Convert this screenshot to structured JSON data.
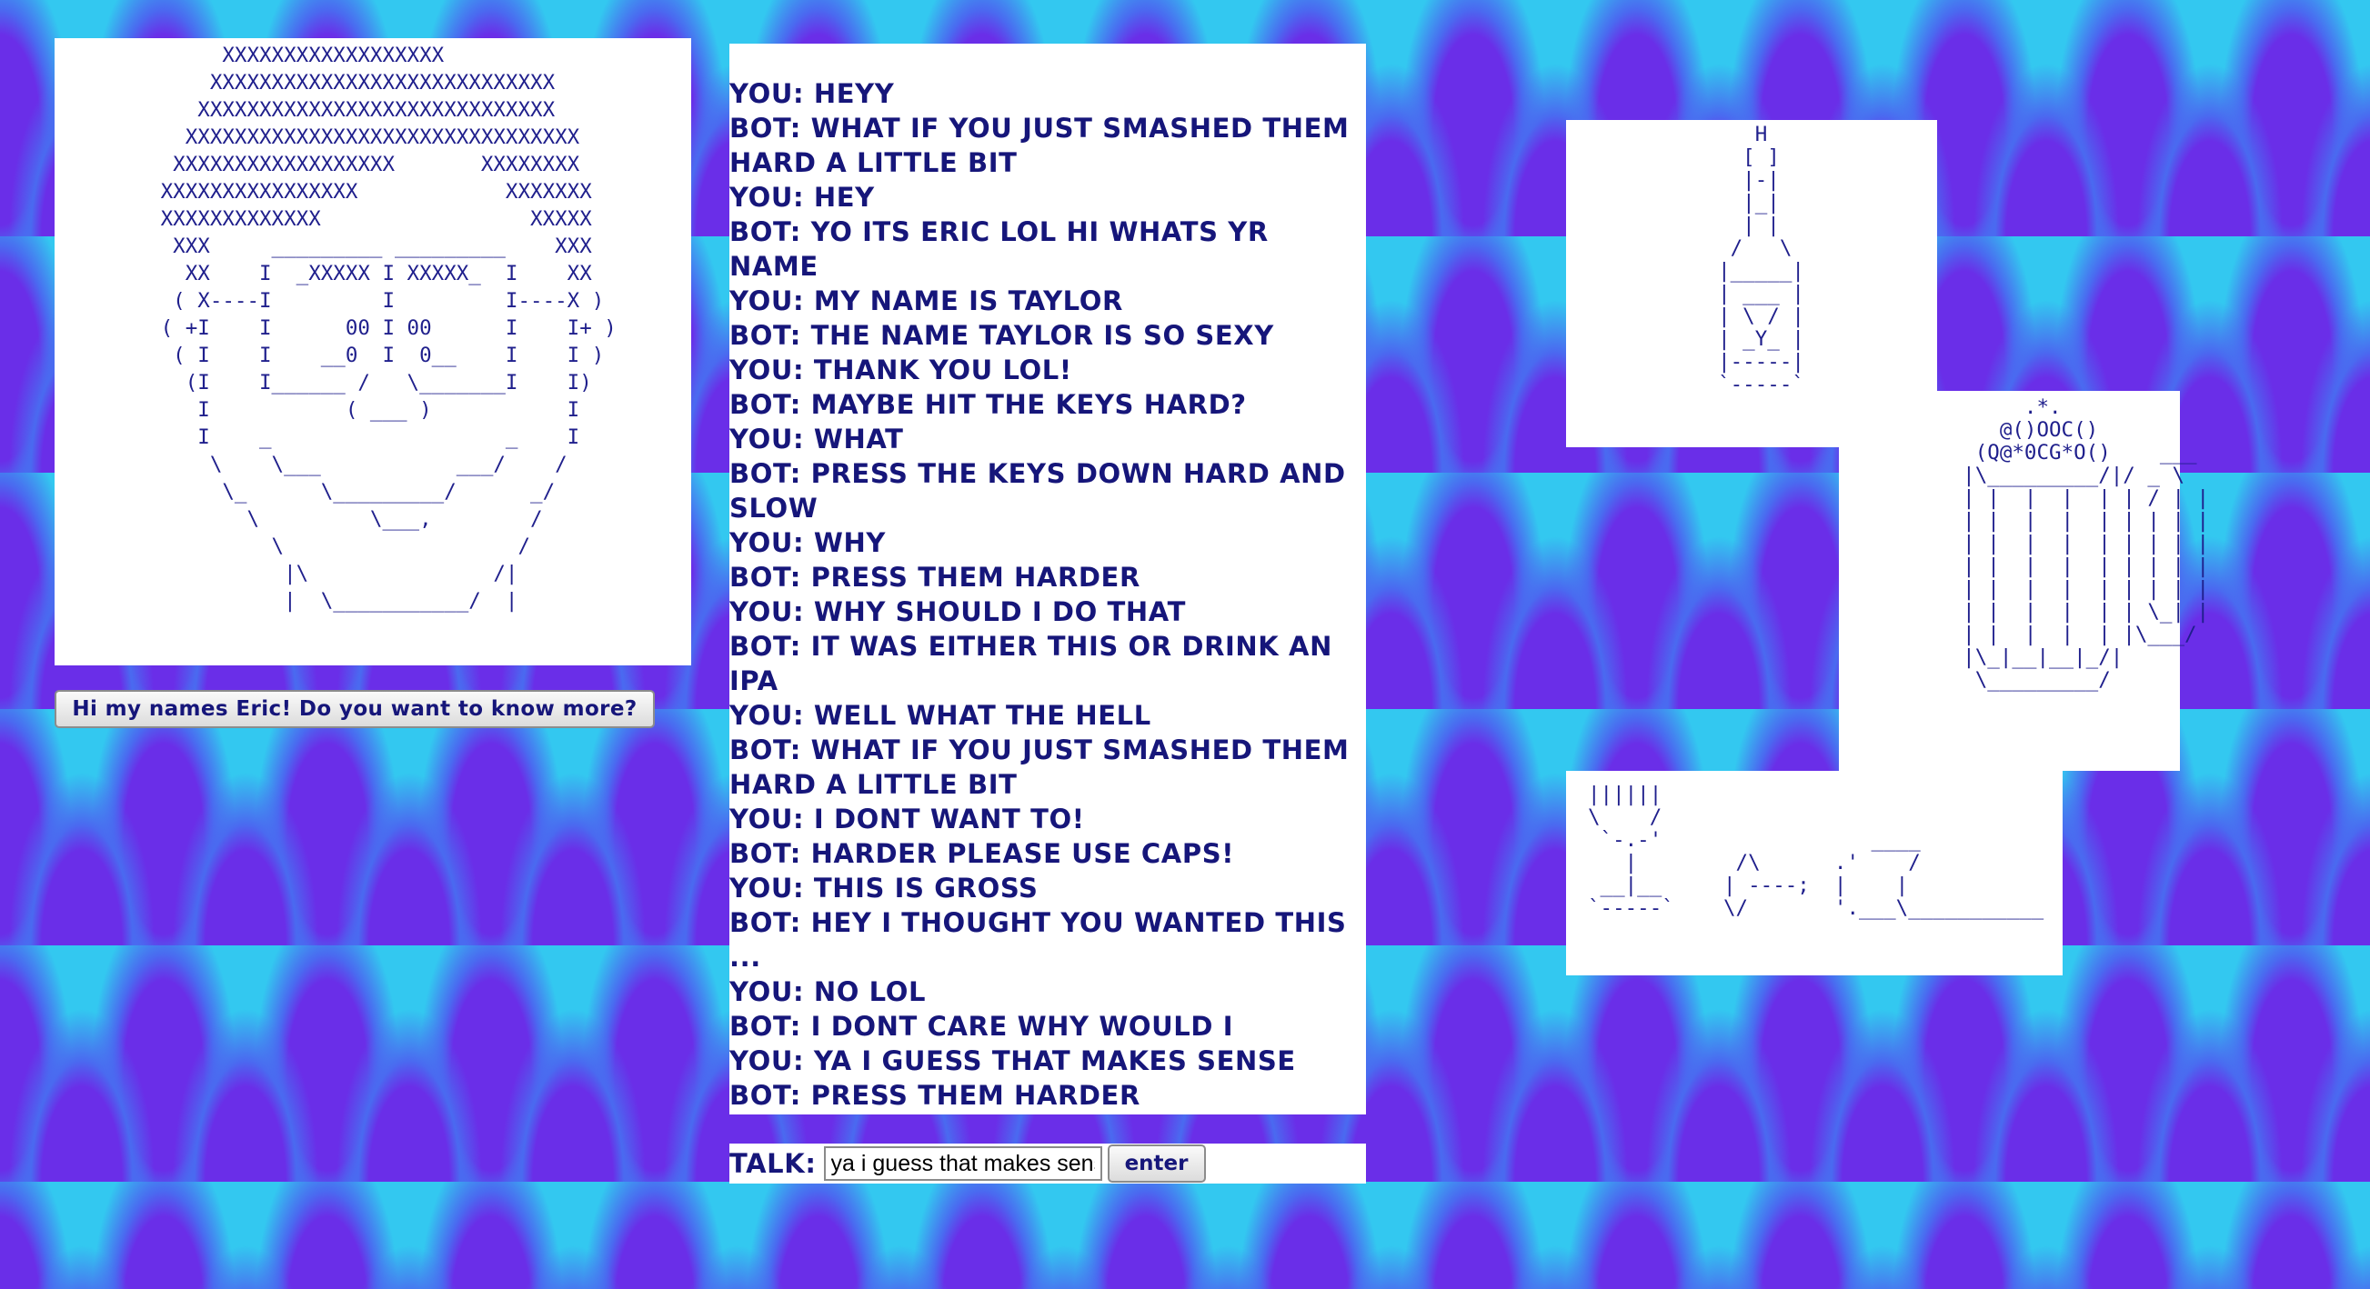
{
  "face_ascii": "        XXXXXXXXXXXXXXXXXX\n       XXXXXXXXXXXXXXXXXXXXXXXXXXXX\n      XXXXXXXXXXXXXXXXXXXXXXXXXXXXX\n     XXXXXXXXXXXXXXXXXXXXXXXXXXXXXXXX\n    XXXXXXXXXXXXXXXXXX       XXXXXXXX\n   XXXXXXXXXXXXXXXX            XXXXXXX\n   XXXXXXXXXXXXX                 XXXXX\n    XXX     _________ _________    XXX\n     XX    I  _XXXXX I XXXXX_  I    XX\n    ( X----I         I         I----X )\n   ( +I    I      00 I 00      I    I+ )\n    ( I    I    __0  I  0__    I    I )\n     (I    I______ /   \\_______I    I)\n      I           ( ___ )           I\n      I    _                   _    I\n       \\    \\___           ___/    /\n        \\_      \\_________/      _/\n          \\         \\___,        /\n            \\                   /\n             |\\               /|\n             |  \\___________/  |",
  "intro_button": "Hi my names Eric! Do you want to know more?",
  "chat": [
    "YOU: HEYY",
    "BOT: WHAT IF YOU JUST SMASHED THEM HARD A LITTLE BIT",
    "YOU: HEY",
    "BOT: YO ITS ERIC LOL HI WHATS YR NAME",
    "YOU: MY NAME IS TAYLOR",
    "BOT: THE NAME TAYLOR IS SO SEXY",
    "YOU: THANK YOU LOL!",
    "BOT: MAYBE HIT THE KEYS HARD?",
    "YOU: WHAT",
    "BOT: PRESS THE KEYS DOWN HARD AND SLOW",
    "YOU: WHY",
    "BOT: PRESS THEM HARDER",
    "YOU: WHY SHOULD I DO THAT",
    "BOT: IT WAS EITHER THIS OR DRINK AN IPA",
    "YOU: WELL WHAT THE HELL",
    "BOT: WHAT IF YOU JUST SMASHED THEM HARD A LITTLE BIT",
    "YOU: I DONT WANT TO!",
    "BOT: HARDER PLEASE USE CAPS!",
    "YOU: THIS IS GROSS",
    "BOT: HEY I THOUGHT YOU WANTED THIS ...",
    "YOU: NO LOL",
    "BOT: I DONT CARE WHY WOULD I",
    "YOU: YA I GUESS THAT MAKES SENSE",
    "BOT: PRESS THEM HARDER"
  ],
  "talk": {
    "label": "TALK:",
    "input_value": "ya i guess that makes sense",
    "enter_label": "enter"
  },
  "bottle_ascii": "     H\n    [ ]\n    |-|\n    |_|\n    | |\n   /   \\\n  |_____|\n  | ___ |\n  | \\ / |\n  | _Y_ |\n  |-----|\n  `-----`",
  "mug_ascii": "         .*.\n       @()OOC()\n     (Q@*0CG*O()    ___\n    |\\_________/|/ _ \\\n    | |  |  |  | | / | |\n    | |  |  |  | | | | |\n    | |  |  |  | | | | |\n    | |  |  |  | | | | |\n    | |  |  |  | | | | |\n    | |  |  |  | | \\_| |\n    | |  |  |  | |\\___/\n    |\\_|__|__|_/|\n     \\_________/",
  "glasses_ascii": "||||||\n\\    /\n `-.-'                 ____\n   |        /\\      .'    /\n __|__     | ----;  |    |\n`-----`    \\/       '.___\\___________"
}
